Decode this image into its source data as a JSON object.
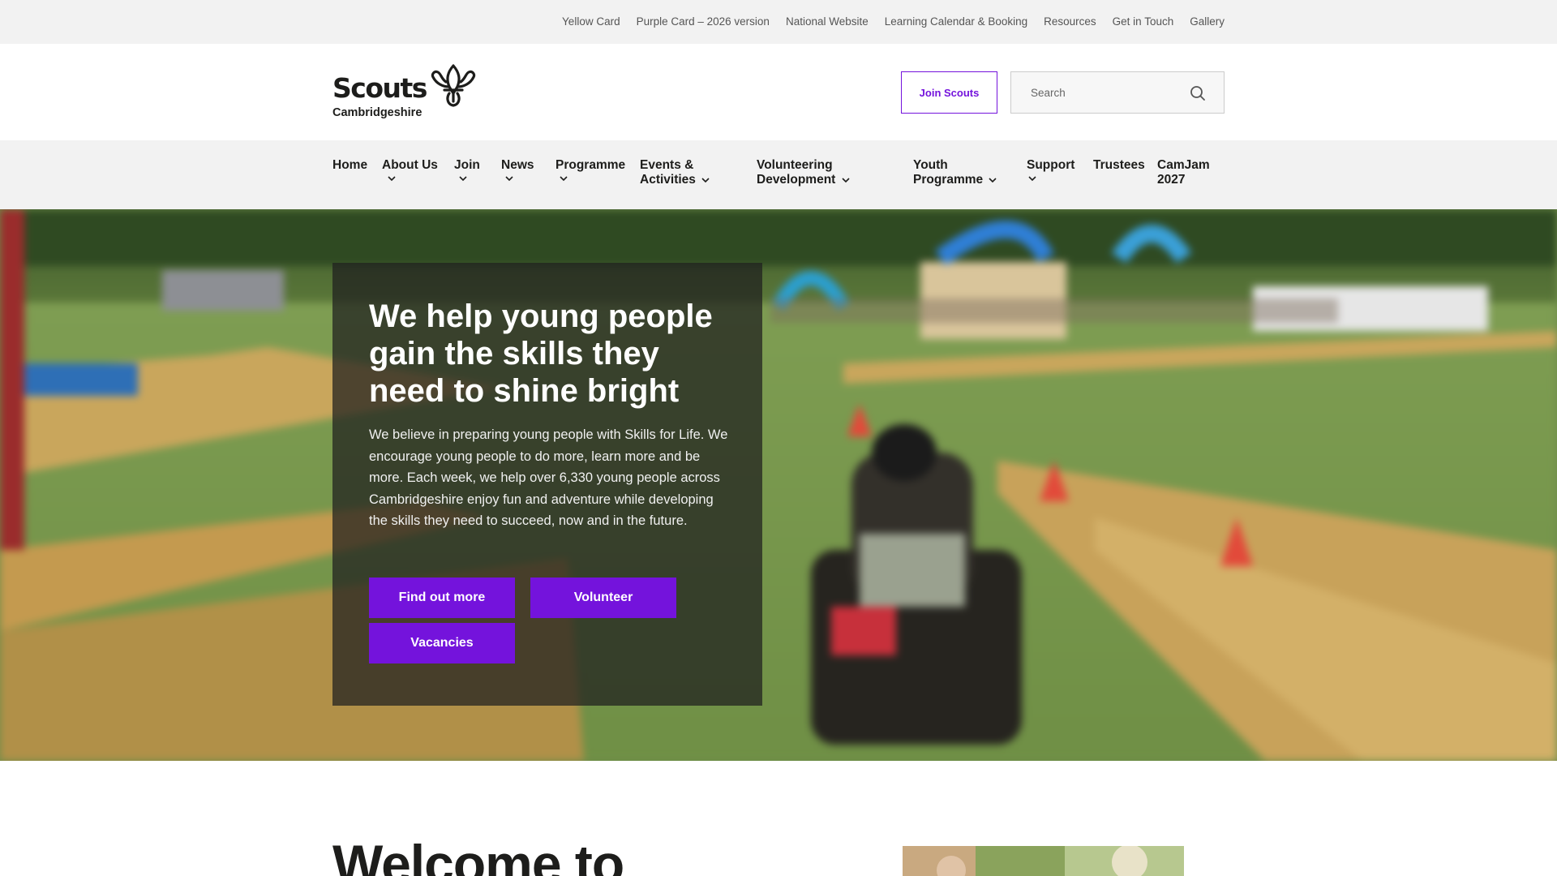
{
  "top_links": [
    "Yellow Card",
    "Purple Card – 2026 version",
    "National Website",
    "Learning Calendar & Booking",
    "Resources",
    "Get in Touch",
    "Gallery"
  ],
  "logo": {
    "wordmark": "Scouts",
    "subtitle": "Cambridgeshire",
    "icon": "fleur-de-lis-icon"
  },
  "header": {
    "join_label": "Join Scouts",
    "search_placeholder": "Search",
    "search_icon": "search-icon"
  },
  "nav": [
    {
      "label": "Home",
      "dropdown": false
    },
    {
      "label": "About Us",
      "dropdown": true
    },
    {
      "label": "Join",
      "dropdown": true
    },
    {
      "label": "News",
      "dropdown": true
    },
    {
      "label": "Programme",
      "dropdown": true
    },
    {
      "label_line1": "Events &",
      "label_line2": "Activities",
      "dropdown": true
    },
    {
      "label_line1": "Volunteering",
      "label_line2": "Development",
      "dropdown": true
    },
    {
      "label_line1": "Youth",
      "label_line2": "Programme",
      "dropdown": true
    },
    {
      "label": "Support",
      "dropdown": true
    },
    {
      "label": "Trustees",
      "dropdown": false
    },
    {
      "label_line1": "CamJam",
      "label_line2": "2027",
      "dropdown": false
    }
  ],
  "hero": {
    "title": "We help young people gain the skills they need to shine bright",
    "text": "We believe in preparing young people with Skills for Life. We encourage young people to do more, learn more and be more. Each week, we help over 6,330 young people across Cambridgeshire enjoy fun and adventure while developing the skills they need to succeed, now and in the future.",
    "buttons": [
      "Find out more",
      "Volunteer",
      "Vacancies"
    ]
  },
  "welcome_heading": "Welcome to",
  "colors": {
    "brand_purple": "#7413dc",
    "text_dark": "#1d1d1b",
    "bar_grey": "#f2f2f2"
  }
}
